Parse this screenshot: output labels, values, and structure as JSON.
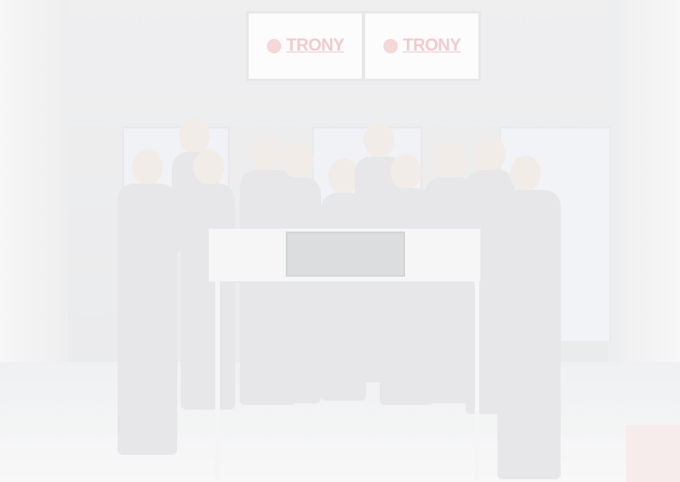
{
  "photo": {
    "description_free": true,
    "signs": [
      {
        "text": "TRONY"
      },
      {
        "text": "TRONY"
      }
    ]
  }
}
